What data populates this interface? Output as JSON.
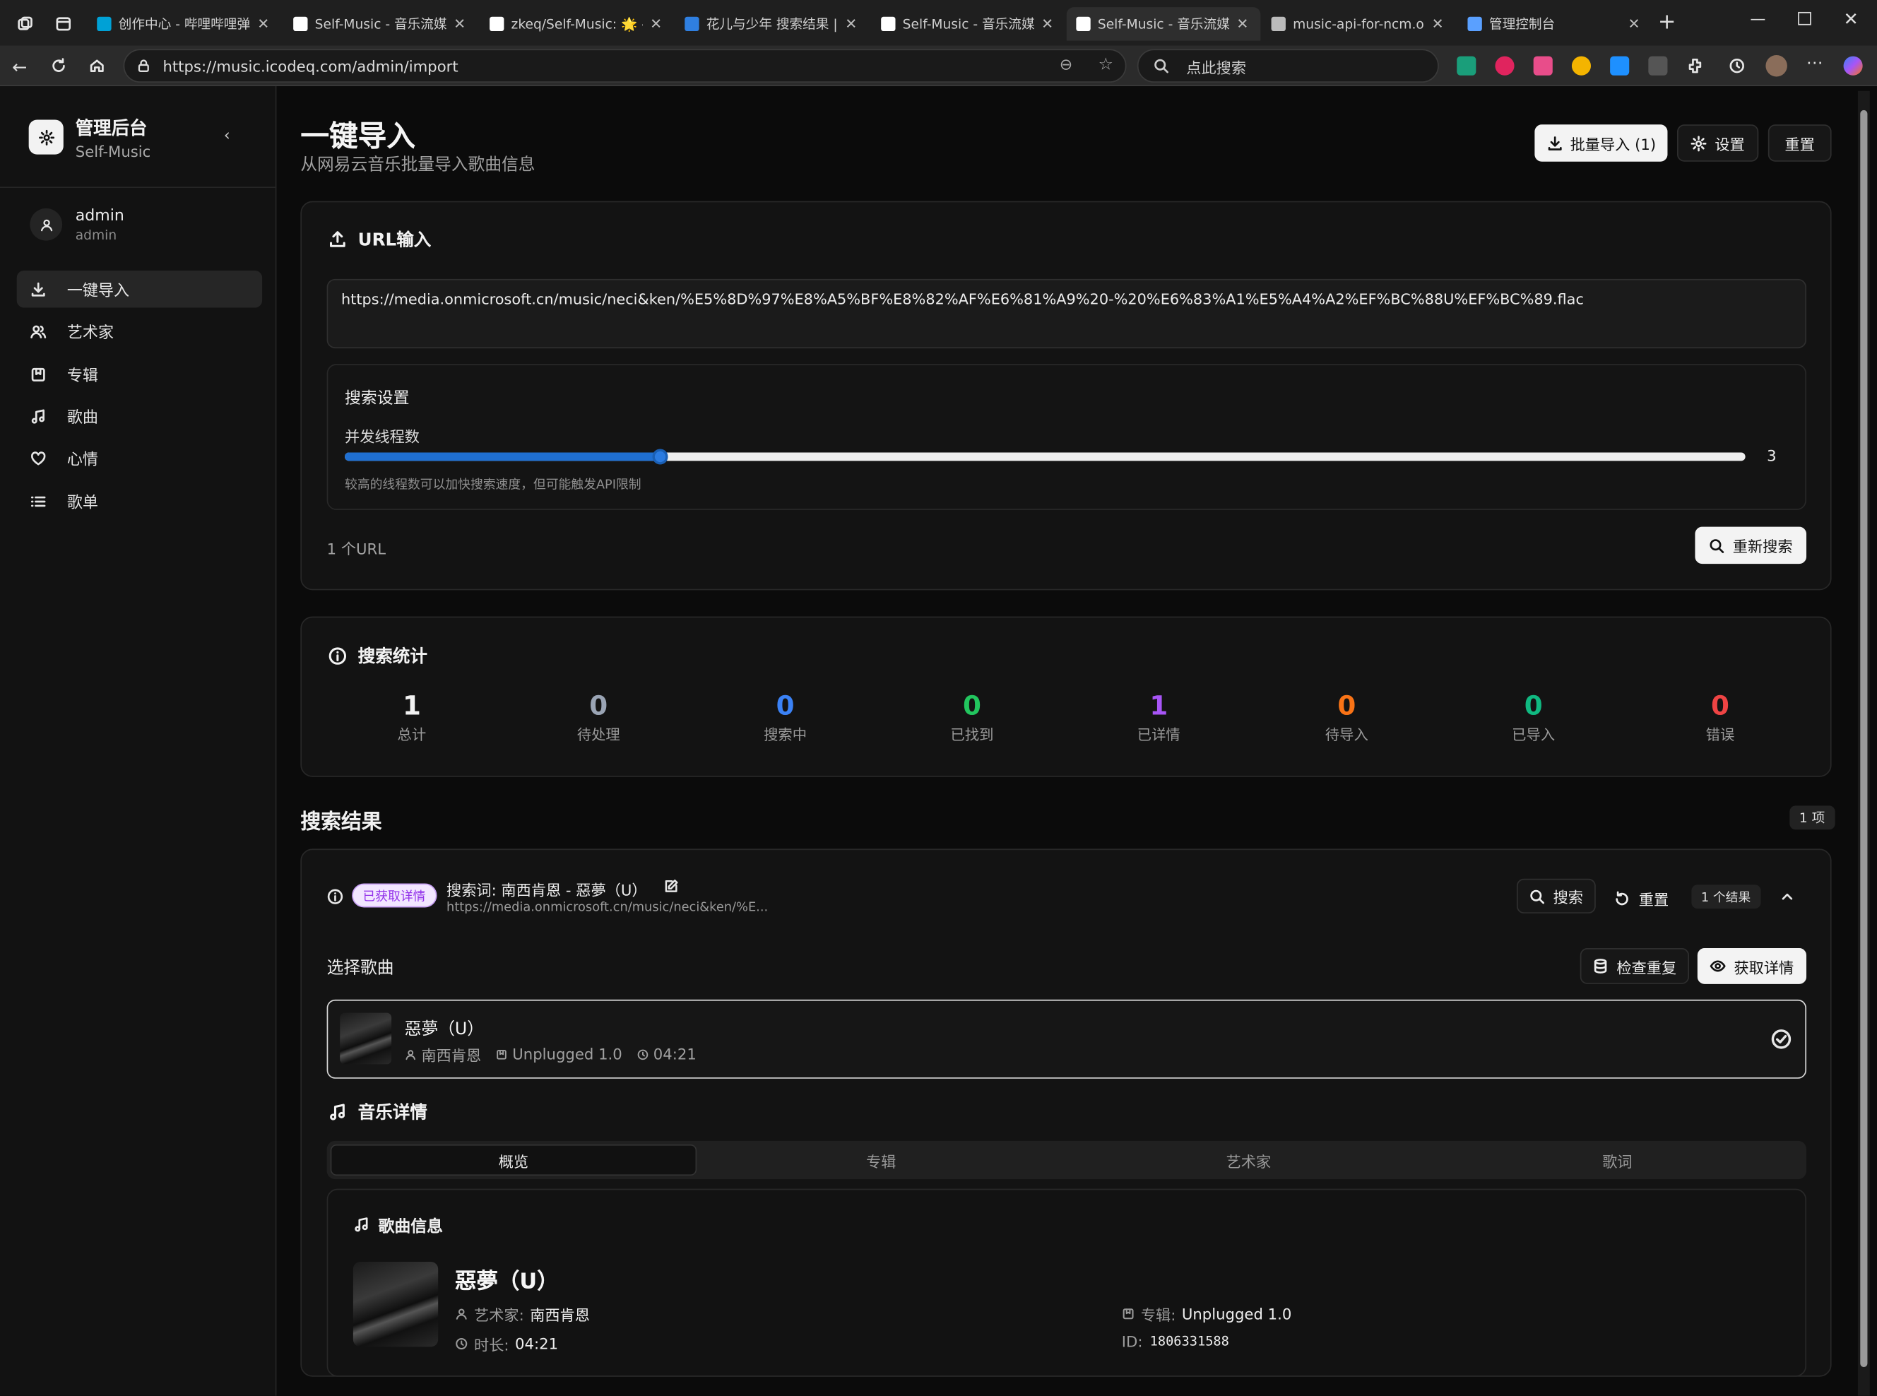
{
  "browser": {
    "tabs": [
      {
        "title": "创作中心 - 哔哩哔哩弹",
        "color": "#00a1d6"
      },
      {
        "title": "Self-Music - 音乐流媒体",
        "color": "#ffffff"
      },
      {
        "title": "zkeq/Self-Music: 🌟 —",
        "color": "#ffffff"
      },
      {
        "title": "花儿与少年 搜索结果 |",
        "color": "#2f7fe0"
      },
      {
        "title": "Self-Music - 音乐流媒体",
        "color": "#ffffff"
      },
      {
        "title": "Self-Music - 音乐流媒体",
        "color": "#ffffff"
      },
      {
        "title": "music-api-for-ncm.onm",
        "color": "#bbbbbb"
      },
      {
        "title": "管理控制台",
        "color": "#5aa0ff"
      }
    ],
    "url": "https://music.icodeq.com/admin/import",
    "search_placeholder": "点此搜索"
  },
  "sidebar": {
    "app_title": "管理后台",
    "app_subtitle": "Self-Music",
    "user_name": "admin",
    "user_role": "admin",
    "items": [
      {
        "label": "一键导入",
        "icon": "download-icon"
      },
      {
        "label": "艺术家",
        "icon": "users-icon"
      },
      {
        "label": "专辑",
        "icon": "album-icon"
      },
      {
        "label": "歌曲",
        "icon": "music-note-icon"
      },
      {
        "label": "心情",
        "icon": "heart-icon"
      },
      {
        "label": "歌单",
        "icon": "list-icon"
      }
    ]
  },
  "header": {
    "title": "一键导入",
    "subtitle": "从网易云音乐批量导入歌曲信息",
    "batch_import": "批量导入 (1)",
    "settings": "设置",
    "reset": "重置"
  },
  "url_input": {
    "title": "URL输入",
    "value": "https://media.onmicrosoft.cn/music/neci&ken/%E5%8D%97%E8%A5%BF%E8%82%AF%E6%81%A9%20-%20%E6%83%A1%E5%A4%A2%EF%BC%88U%EF%BC%89.flac",
    "search_settings_title": "搜索设置",
    "threads_label": "并发线程数",
    "threads_value": "3",
    "threads_fraction": 0.225,
    "threads_hint": "较高的线程数可以加快搜索速度，但可能触发API限制",
    "url_count": "1 个URL",
    "research": "重新搜索"
  },
  "stats": {
    "title": "搜索统计",
    "items": [
      {
        "value": "1",
        "label": "总计",
        "color": "#f2f2f2"
      },
      {
        "value": "0",
        "label": "待处理",
        "color": "#9aa4b4"
      },
      {
        "value": "0",
        "label": "搜索中",
        "color": "#3b82f6"
      },
      {
        "value": "0",
        "label": "已找到",
        "color": "#22c55e"
      },
      {
        "value": "1",
        "label": "已详情",
        "color": "#a855f7"
      },
      {
        "value": "0",
        "label": "待导入",
        "color": "#f97316"
      },
      {
        "value": "0",
        "label": "已导入",
        "color": "#10b981"
      },
      {
        "value": "0",
        "label": "错误",
        "color": "#ef4444"
      }
    ]
  },
  "results": {
    "title": "搜索结果",
    "count_badge": "1 项",
    "status_badge": "已获取详情",
    "query": "搜索词: 南西肯恩 - 惡夢（U）",
    "query_url": "https://media.onmicrosoft.cn/music/neci&ken/%E...",
    "search": "搜索",
    "reset": "重置",
    "result_count": "1 个结果",
    "select_title": "选择歌曲",
    "check_dup": "检查重复",
    "fetch_detail": "获取详情",
    "song": {
      "name": "惡夢（U）",
      "artist": "南西肯恩",
      "album": "Unplugged 1.0",
      "duration": "04:21"
    }
  },
  "detail": {
    "title": "音乐详情",
    "tabs": [
      "概览",
      "专辑",
      "艺术家",
      "歌词"
    ],
    "info_title": "歌曲信息",
    "song_name": "惡夢（U）",
    "artist_label": "艺术家:",
    "artist": "南西肯恩",
    "duration_label": "时长:",
    "duration": "04:21",
    "album_label": "专辑:",
    "album": "Unplugged 1.0",
    "id_label": "ID:",
    "id": "1806331588"
  }
}
